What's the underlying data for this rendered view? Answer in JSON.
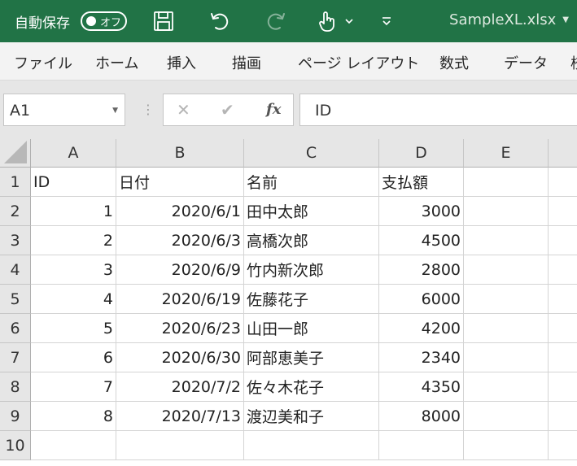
{
  "titlebar": {
    "autosave_label": "自動保存",
    "autosave_state": "オフ",
    "filename": "SampleXL.xlsx",
    "icons": [
      "save-icon",
      "undo-icon",
      "redo-icon",
      "touch-mode-icon",
      "chevron-down-icon",
      "customize-qat-icon"
    ]
  },
  "ribbon": {
    "tabs": [
      "ファイル",
      "ホーム",
      "挿入",
      "描画",
      "ページ レイアウト",
      "数式",
      "データ",
      "校"
    ]
  },
  "formula_bar": {
    "name_box": "A1",
    "separator": "⋮",
    "cancel": "✕",
    "enter": "✔",
    "fx": "fx",
    "content": "ID"
  },
  "sheet": {
    "column_headers": [
      "A",
      "B",
      "C",
      "D",
      "E"
    ],
    "row_headers": [
      "1",
      "2",
      "3",
      "4",
      "5",
      "6",
      "7",
      "8",
      "9",
      "10"
    ],
    "rows": [
      [
        "ID",
        "日付",
        "名前",
        "支払額",
        ""
      ],
      [
        "1",
        "2020/6/1",
        "田中太郎",
        "3000",
        ""
      ],
      [
        "2",
        "2020/6/3",
        "高橋次郎",
        "4500",
        ""
      ],
      [
        "3",
        "2020/6/9",
        "竹内新次郎",
        "2800",
        ""
      ],
      [
        "4",
        "2020/6/19",
        "佐藤花子",
        "6000",
        ""
      ],
      [
        "5",
        "2020/6/23",
        "山田一郎",
        "4200",
        ""
      ],
      [
        "6",
        "2020/6/30",
        "阿部恵美子",
        "2340",
        ""
      ],
      [
        "7",
        "2020/7/2",
        "佐々木花子",
        "4350",
        ""
      ],
      [
        "8",
        "2020/7/13",
        "渡辺美和子",
        "8000",
        ""
      ],
      [
        "",
        "",
        "",
        "",
        ""
      ]
    ]
  },
  "colors": {
    "title_bar": "#217346",
    "ribbon_bg": "#f3f3f3",
    "header_bg": "#e6e6e6"
  }
}
